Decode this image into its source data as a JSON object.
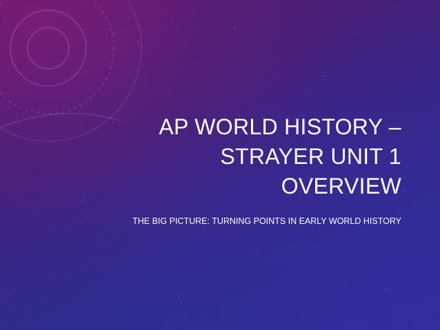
{
  "slide": {
    "title_lines": [
      "AP WORLD HISTORY –",
      "STRAYER UNIT 1",
      "OVERVIEW"
    ],
    "subtitle": "THE BIG PICTURE:  TURNING POINTS IN EARLY WORLD HISTORY"
  },
  "colors": {
    "background_top_left": "#5a1a6e",
    "background_bottom_right": "#283394",
    "text": "#ffffff"
  }
}
